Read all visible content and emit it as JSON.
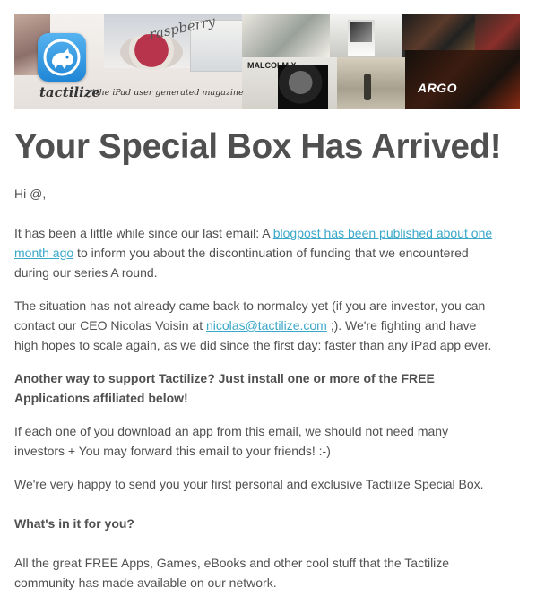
{
  "banner": {
    "brand_name": "tactilize",
    "tagline": "*the iPad user generated magazine",
    "collage_texts": {
      "script_word": "raspberry",
      "portrait_label": "MALCOLM X",
      "poster_title": "ARGO"
    }
  },
  "headline": "Your Special Box Has Arrived!",
  "greeting": "Hi @,",
  "para1": {
    "before": "It has been a little while since our last email: A ",
    "link_line1": "blogpost has been published about one",
    "link_line2": "month ago",
    "after_line2": " to inform you about the discontinuation of funding that we encountered",
    "line3": "during our series A round."
  },
  "para2": {
    "line1": "The situation has not already came back to normalcy yet (if you are investor, you can",
    "line2_before": "contact our CEO Nicolas Voisin at ",
    "email": "nicolas@tactilize.com",
    "line2_after": " ;). We're fighting and have",
    "line3": "high hopes to scale again, as we did since the first day: faster than any iPad app ever."
  },
  "para3": {
    "line1": "Another way to support Tactilize? Just install one or more of the FREE",
    "line2": "Applications affiliated below!"
  },
  "para4": {
    "line1": "If each one of you download an app from this email, we should not need many",
    "line2": "investors + You may forward this email to your friends!  :-)"
  },
  "para5": "We're very happy to send you your first personal and exclusive Tactilize Special Box.",
  "para6": "What's in it for you?",
  "para7": {
    "line1": "All the great FREE Apps, Games, eBooks and other cool stuff that the Tactilize",
    "line2": "community has made available on our network."
  },
  "colors": {
    "text": "#505050",
    "link": "#3aa8c9",
    "app_icon": "#2a8fd9"
  },
  "icons": [
    "tactilize-app-icon"
  ]
}
